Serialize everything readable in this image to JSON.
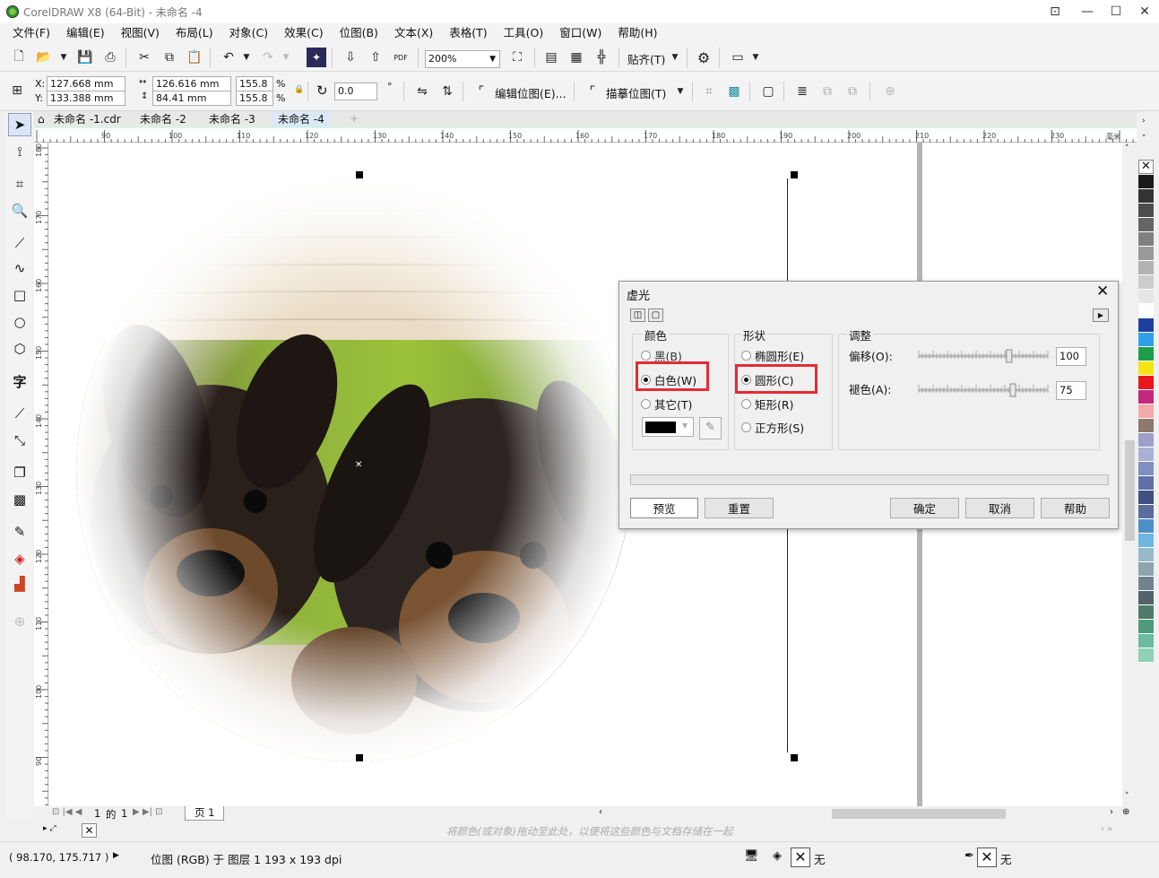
{
  "window": {
    "title": "CorelDRAW X8 (64-Bit) - 未命名 -4"
  },
  "menu": [
    "文件(F)",
    "编辑(E)",
    "视图(V)",
    "布局(L)",
    "对象(C)",
    "效果(C)",
    "位图(B)",
    "文本(X)",
    "表格(T)",
    "工具(O)",
    "窗口(W)",
    "帮助(H)"
  ],
  "toolbar": {
    "zoom": "200%",
    "snap_label": "贴齐(T)",
    "pdf_label": "PDF"
  },
  "propbar": {
    "x_label": "X:",
    "x": "127.668 mm",
    "y_label": "Y:",
    "y": "133.388 mm",
    "w": "126.616 mm",
    "h": "84.41 mm",
    "sw": "155.8",
    "sh": "155.8",
    "pct": "%",
    "angle": "0.0",
    "deg": "°",
    "edit_bitmap": "编辑位图(E)...",
    "trace_bitmap": "描摹位图(T)"
  },
  "tabs": [
    "未命名 -1.cdr",
    "未命名 -2",
    "未命名 -3",
    "未命名 -4"
  ],
  "ruler": {
    "h": [
      "90",
      "100",
      "110",
      "120",
      "130",
      "140",
      "150",
      "160",
      "170",
      "180",
      "190",
      "200",
      "210",
      "220",
      "230"
    ],
    "unit": "毫米",
    "v": [
      "180",
      "170",
      "160",
      "150",
      "140",
      "130",
      "120",
      "110",
      "100",
      "90"
    ]
  },
  "dialog": {
    "title": "虚光",
    "color_group": "颜色",
    "color_options": [
      "黑(B)",
      "白色(W)",
      "其它(T)"
    ],
    "shape_group": "形状",
    "shape_options": [
      "椭圆形(E)",
      "圆形(C)",
      "矩形(R)",
      "正方形(S)"
    ],
    "adjust_group": "调整",
    "offset_label": "偏移(O):",
    "offset_value": "100",
    "fade_label": "褪色(A):",
    "fade_value": "75",
    "buttons": {
      "preview": "预览",
      "reset": "重置",
      "ok": "确定",
      "cancel": "取消",
      "help": "帮助"
    },
    "offset_level": 0.72,
    "fade_level": 0.75
  },
  "page_nav": {
    "current": "1",
    "of": "的",
    "total": "1",
    "page_tab": "页 1"
  },
  "palette_hint": "将颜色(或对象)拖动至此处，以便将这些颜色与文档存储在一起",
  "status": {
    "coords": "( 98.170, 175.717 )",
    "info": "位图 (RGB) 于 图层 1 193 x 193 dpi",
    "fill_none": "无",
    "outline_none": "无"
  },
  "palette_colors": [
    "#1a1a1a",
    "#333333",
    "#4d4d4d",
    "#666666",
    "#808080",
    "#999999",
    "#b3b3b3",
    "#cccccc",
    "#e6e6e6",
    "#ffffff",
    "#1f3f9f",
    "#2fa0e8",
    "#1a9e4a",
    "#f5e514",
    "#e8171e",
    "#c2287e",
    "#f2a9a9",
    "#8c7a6b",
    "#9fa0c8",
    "#a9b2d6",
    "#7f8fbf",
    "#5f6faa",
    "#40507f",
    "#5c6c9a",
    "#4d8fc7",
    "#6fb6e0",
    "#98b8cc",
    "#8ea5ad",
    "#6f838a",
    "#52626a",
    "#4f7a6a",
    "#4d9a7a",
    "#6abba0",
    "#8fd0b8"
  ]
}
